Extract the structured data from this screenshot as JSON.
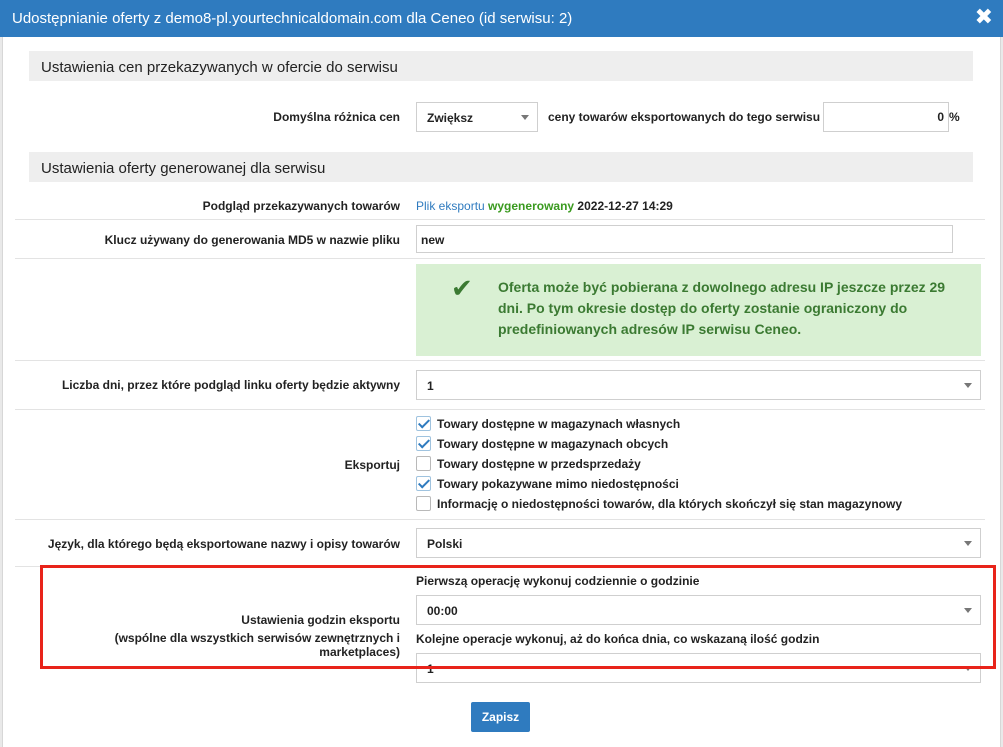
{
  "dialog": {
    "title": "Udostępnianie oferty z demo8-pl.yourtechnicaldomain.com dla Ceneo (id serwisu: 2)",
    "close_glyph": "✖"
  },
  "price_section": {
    "heading": "Ustawienia cen przekazywanych w ofercie do serwisu",
    "default_diff_label": "Domyślna różnica cen",
    "direction_value": "Zwiększ",
    "middle_text": "ceny towarów eksportowanych do tego serwisu o",
    "percent_value": "0",
    "percent_unit": "%"
  },
  "offer_section": {
    "heading": "Ustawienia oferty generowanej dla serwisu",
    "preview_label": "Podgląd przekazywanych towarów",
    "preview_link": "Plik eksportu",
    "preview_status": "wygenerowany",
    "preview_date": "2022-12-27 14:29",
    "md5_label": "Klucz używany do generowania MD5 w nazwie pliku",
    "md5_value": "new",
    "alert_icon": "check-icon",
    "alert_text": "Oferta może być pobierana z dowolnego adresu IP jeszcze przez 29 dni. Po tym okresie dostęp do oferty zostanie ograniczony do predefiniowanych adresów IP serwisu Ceneo.",
    "days_label": "Liczba dni, przez które podgląd linku oferty będzie aktywny",
    "days_value": "1",
    "export_label": "Eksportuj",
    "export_options": [
      {
        "label": "Towary dostępne w magazynach własnych",
        "checked": true
      },
      {
        "label": "Towary dostępne w magazynach obcych",
        "checked": true
      },
      {
        "label": "Towary dostępne w przedsprzedaży",
        "checked": false
      },
      {
        "label": "Towary pokazywane mimo niedostępności",
        "checked": true
      },
      {
        "label": "Informację o niedostępności towarów, dla których skończył się stan magazynowy",
        "checked": false
      }
    ],
    "language_label": "Język, dla którego będą eksportowane nazwy i opisy towarów",
    "language_value": "Polski",
    "hours_label_1": "Ustawienia godzin eksportu",
    "hours_label_2": "(wspólne dla wszystkich serwisów zewnętrznych i marketplaces)",
    "first_op_label": "Pierwszą operację wykonuj codziennie o godzinie",
    "first_op_value": "00:00",
    "next_op_label": "Kolejne operacje wykonuj, aż do końca dnia, co wskazaną ilość godzin",
    "next_op_value": "1"
  },
  "save_button": "Zapisz",
  "colors": {
    "accent": "#2f7bbf",
    "highlight": "#e8231a",
    "alert_bg": "#d9f0d3",
    "alert_text": "#3b7a32"
  }
}
